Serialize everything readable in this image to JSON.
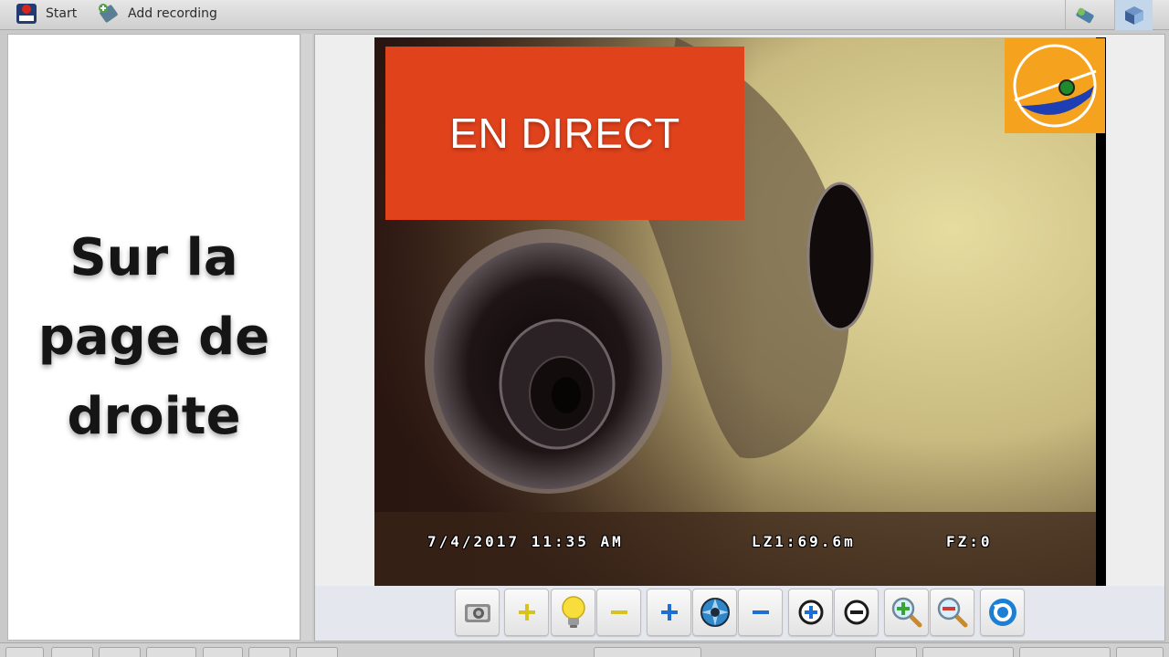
{
  "toolbar": {
    "start_label": "Start",
    "add_recording_label": "Add recording"
  },
  "left_panel": {
    "message_line1": "Sur la",
    "message_line2": "page de",
    "message_line3": "droite"
  },
  "video": {
    "live_badge": "EN DIRECT",
    "date_time": "7/4/2017 11:35 AM",
    "distance": "LZ1:69.6m",
    "focus_zoom": "FZ:0"
  },
  "controls": [
    {
      "name": "snapshot-button",
      "icon": "camera-icon"
    },
    {
      "name": "light-increase-button",
      "icon": "plus-yellow-icon"
    },
    {
      "name": "light-toggle-button",
      "icon": "lightbulb-icon"
    },
    {
      "name": "light-decrease-button",
      "icon": "minus-yellow-icon"
    },
    {
      "name": "iris-increase-button",
      "icon": "plus-blue-icon"
    },
    {
      "name": "iris-button",
      "icon": "aperture-icon"
    },
    {
      "name": "iris-decrease-button",
      "icon": "minus-blue-icon"
    },
    {
      "name": "focus-in-button",
      "icon": "circle-plus-icon"
    },
    {
      "name": "focus-out-button",
      "icon": "circle-minus-icon"
    },
    {
      "name": "zoom-in-button",
      "icon": "zoom-in-icon"
    },
    {
      "name": "zoom-out-button",
      "icon": "zoom-out-icon"
    },
    {
      "name": "reset-button",
      "icon": "rotate-icon"
    }
  ],
  "colors": {
    "live_badge": "#e0421c",
    "incline_badge": "#f5a21e",
    "plus_yellow": "#d6c320",
    "plus_blue": "#1f6fd1"
  }
}
